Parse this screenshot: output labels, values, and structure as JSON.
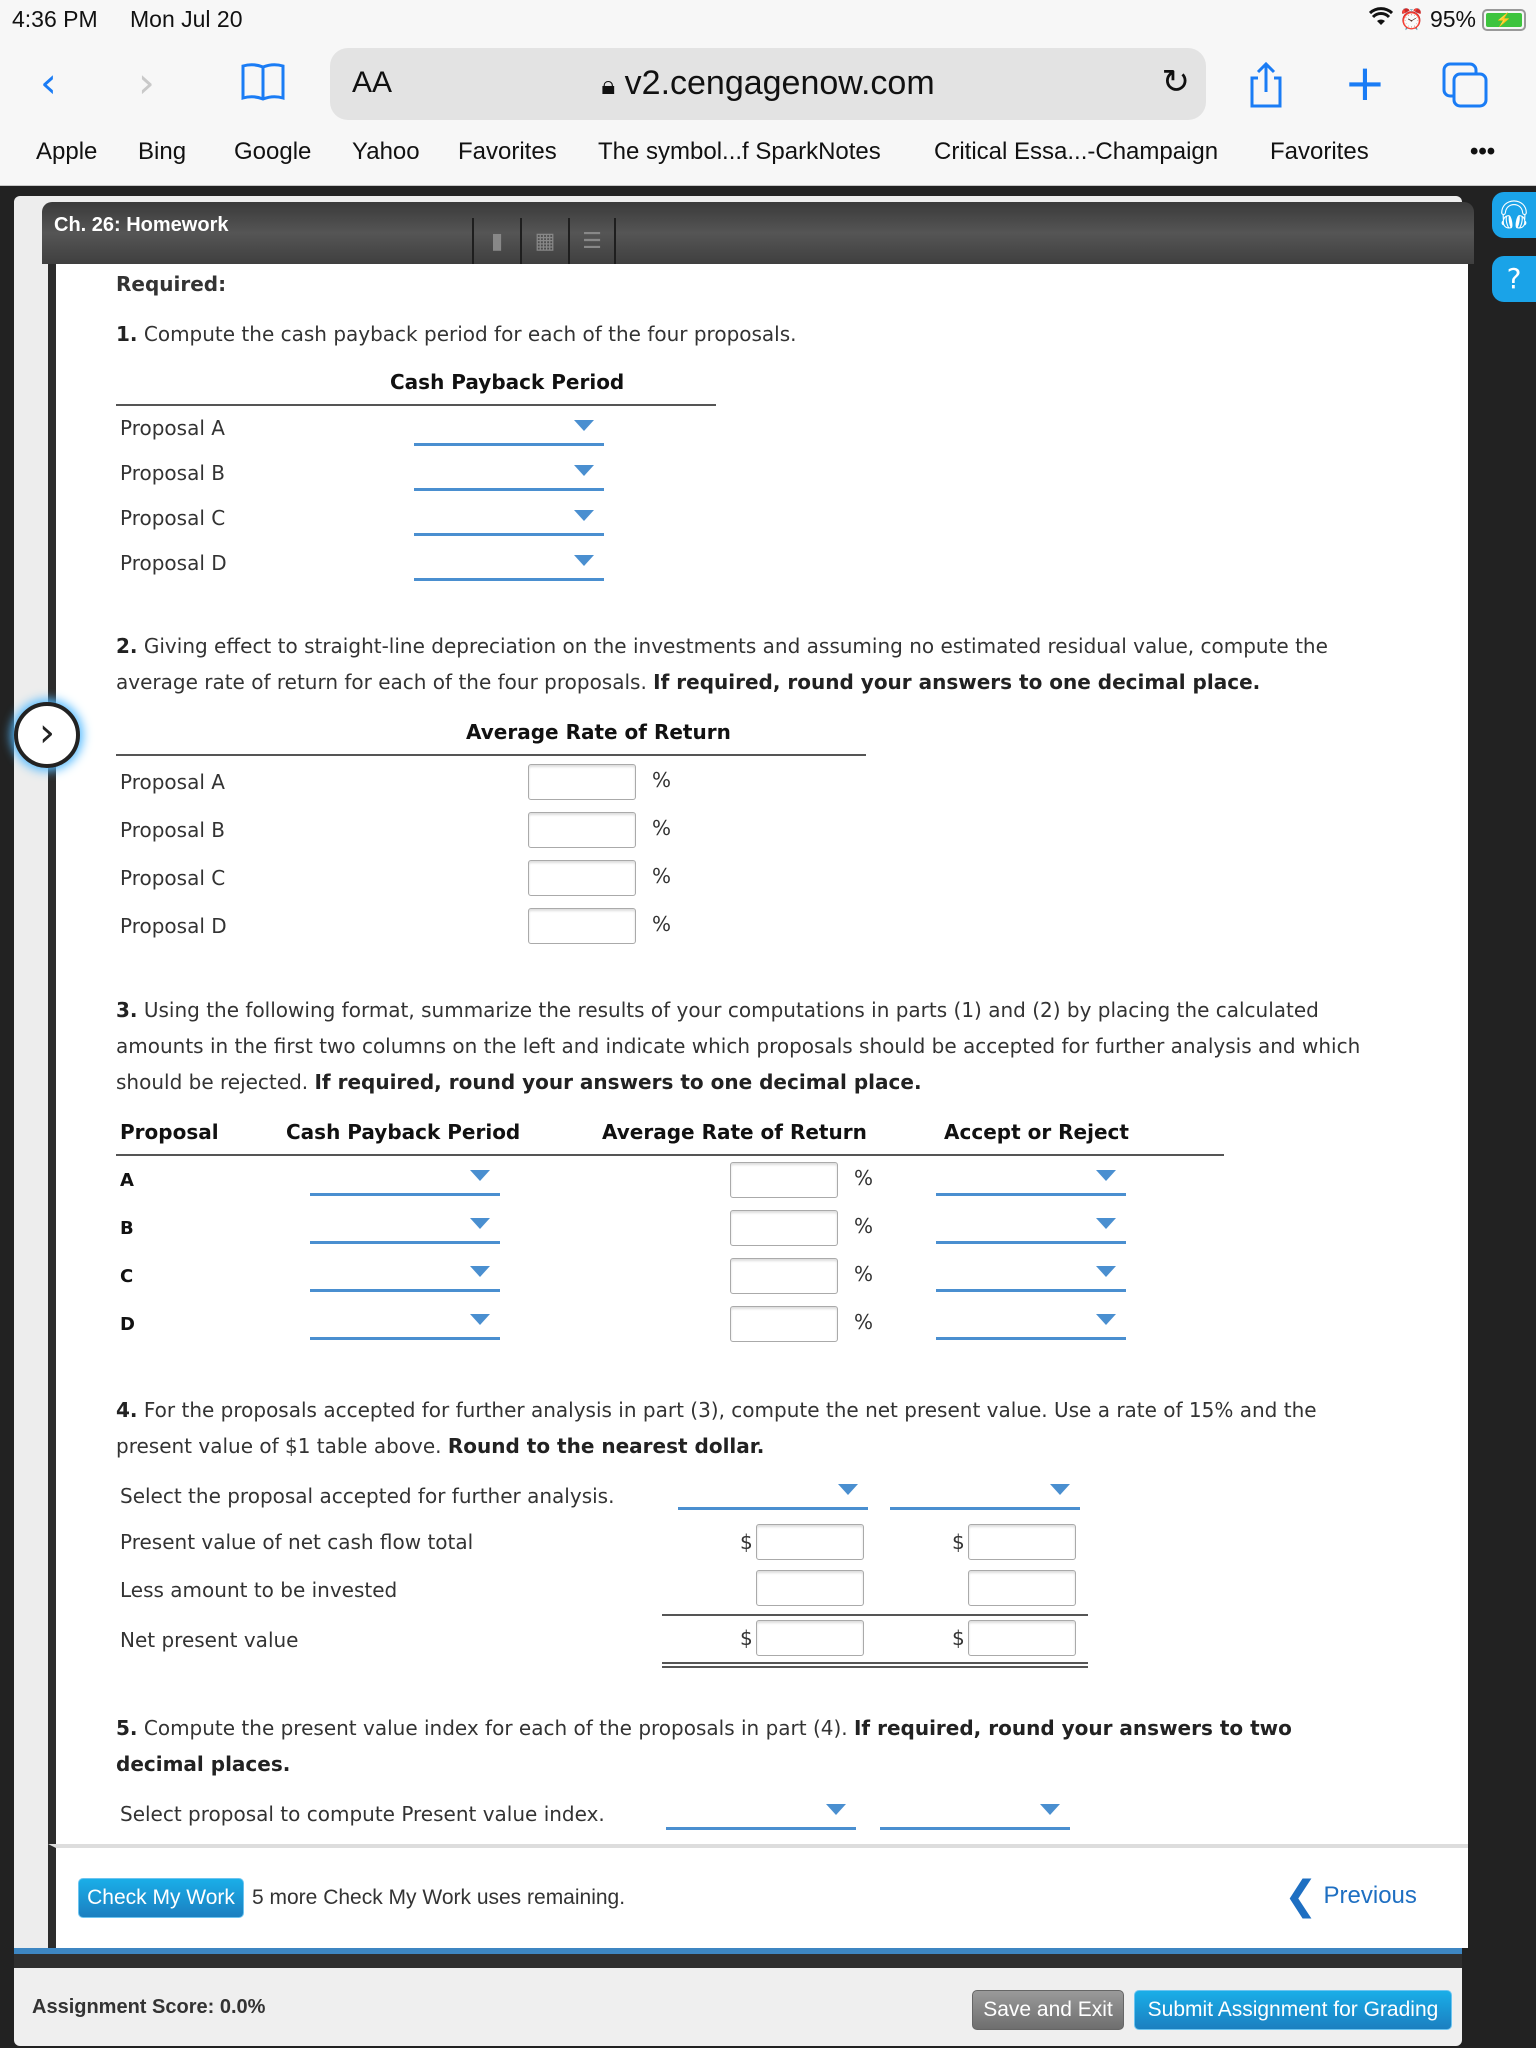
{
  "status_bar": {
    "time": "4:36 PM",
    "date": "Mon Jul 20",
    "battery": "95%",
    "icons": [
      "wifi-icon",
      "alarm-icon",
      "battery-charging-icon"
    ]
  },
  "browser": {
    "text_size_label": "AA",
    "url": "v2.cengagenow.com",
    "bookmarks": [
      "Apple",
      "Bing",
      "Google",
      "Yahoo",
      "Favorites",
      "The symbol...f SparkNotes",
      "Critical Essa...-Champaign",
      "Favorites"
    ],
    "more_label": "•••",
    "icons": {
      "back": "‹",
      "forward": "›",
      "bookmarks": "book-icon",
      "reload": "↻",
      "share": "share-icon",
      "new_tab": "+",
      "tabs": "tabs-icon"
    }
  },
  "app": {
    "title": "Ch. 26: Homework",
    "toolbar_icons": [
      "ebook-icon",
      "calculator-icon",
      "notes-icon"
    ],
    "side_buttons": [
      "headset-icon",
      "help-icon"
    ]
  },
  "content": {
    "required_label": "Required:",
    "part1": {
      "number": "1.",
      "text": "Compute the cash payback period for each of the four proposals.",
      "column_header": "Cash Payback Period",
      "rows": [
        "Proposal A",
        "Proposal B",
        "Proposal C",
        "Proposal D"
      ]
    },
    "part2": {
      "number": "2.",
      "text_line1": "Giving effect to straight-line depreciation on the investments and assuming no estimated residual value, compute the",
      "text_line2": "average rate of return for each of the four proposals.",
      "emphasis": "If required, round your answers to one decimal place.",
      "column_header": "Average Rate of Return",
      "rows": [
        "Proposal A",
        "Proposal B",
        "Proposal C",
        "Proposal D"
      ],
      "unit": "%"
    },
    "part3": {
      "number": "3.",
      "text_line1": "Using the following format, summarize the results of your computations in parts (1) and (2) by placing the calculated",
      "text_line2": "amounts in the first two columns on the left and indicate which proposals should be accepted for further analysis and which",
      "text_line3": "should be rejected.",
      "emphasis": "If required, round your answers to one decimal place.",
      "headers": [
        "Proposal",
        "Cash Payback Period",
        "Average Rate of Return",
        "Accept or Reject"
      ],
      "rows": [
        "A",
        "B",
        "C",
        "D"
      ],
      "unit": "%"
    },
    "part4": {
      "number": "4.",
      "text_line1": "For the proposals accepted for further analysis in part (3), compute the net present value. Use a rate of 15% and the",
      "text_line2": "present value of $1 table above.",
      "emphasis": "Round to the nearest dollar.",
      "rows": [
        "Select the proposal accepted for further analysis.",
        "Present value of net cash flow total",
        "Less amount to be invested",
        "Net present value"
      ],
      "currency": "$"
    },
    "part5": {
      "number": "5.",
      "text_line1": "Compute the present value index for each of the proposals in part (4).",
      "emphasis_line1": "If required, round your answers to two",
      "emphasis_line2": "decimal places.",
      "select_label": "Select proposal to compute Present value index."
    }
  },
  "footer": {
    "check_button": "Check My Work",
    "remaining_text": "5 more Check My Work uses remaining.",
    "previous_label": "Previous",
    "score_label": "Assignment Score: 0.0%",
    "save_exit": "Save and Exit",
    "submit": "Submit Assignment for Grading"
  }
}
